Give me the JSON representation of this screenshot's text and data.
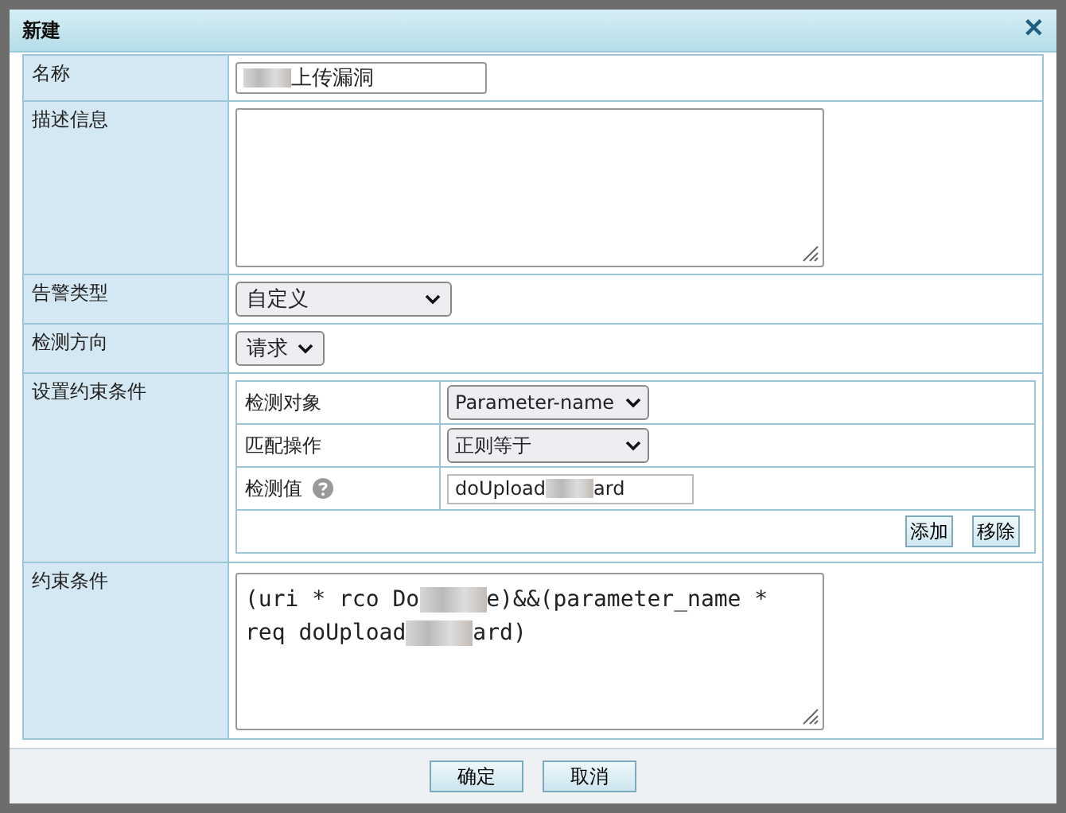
{
  "dialog": {
    "title": "新建",
    "close": "✕"
  },
  "form": [
    {
      "kind": "text",
      "label": "名称",
      "value": [
        {
          "kind": "blur"
        },
        {
          "kind": "text",
          "text": "上传漏洞"
        }
      ]
    },
    {
      "kind": "textarea",
      "label": "描述信息"
    },
    {
      "kind": "select",
      "label": "告警类型",
      "value": "自定义"
    },
    {
      "kind": "select",
      "label": "检测方向",
      "value": "请求"
    },
    {
      "kind": "conditions",
      "label": "设置约束条件",
      "rows": [
        {
          "kind": "select",
          "label": "检测对象",
          "value": "Parameter-name"
        },
        {
          "kind": "select",
          "label": "匹配操作",
          "value": "正则等于"
        },
        {
          "kind": "text",
          "label": "检测值",
          "help": true,
          "value": [
            {
              "kind": "text",
              "text": "doUpload"
            },
            {
              "kind": "blur"
            },
            {
              "kind": "text",
              "text": "ard"
            }
          ]
        }
      ],
      "buttons": [
        "添加",
        "移除"
      ]
    },
    {
      "kind": "textarea",
      "label": "约束条件",
      "value": [
        {
          "kind": "text",
          "text": "(uri * rco Do"
        },
        {
          "kind": "blur"
        },
        {
          "kind": "text",
          "text": "e)&&(parameter_name * req doUpload"
        },
        {
          "kind": "blur"
        },
        {
          "kind": "text",
          "text": "ard)"
        }
      ]
    }
  ],
  "buttons": [
    "确定",
    "取消"
  ]
}
